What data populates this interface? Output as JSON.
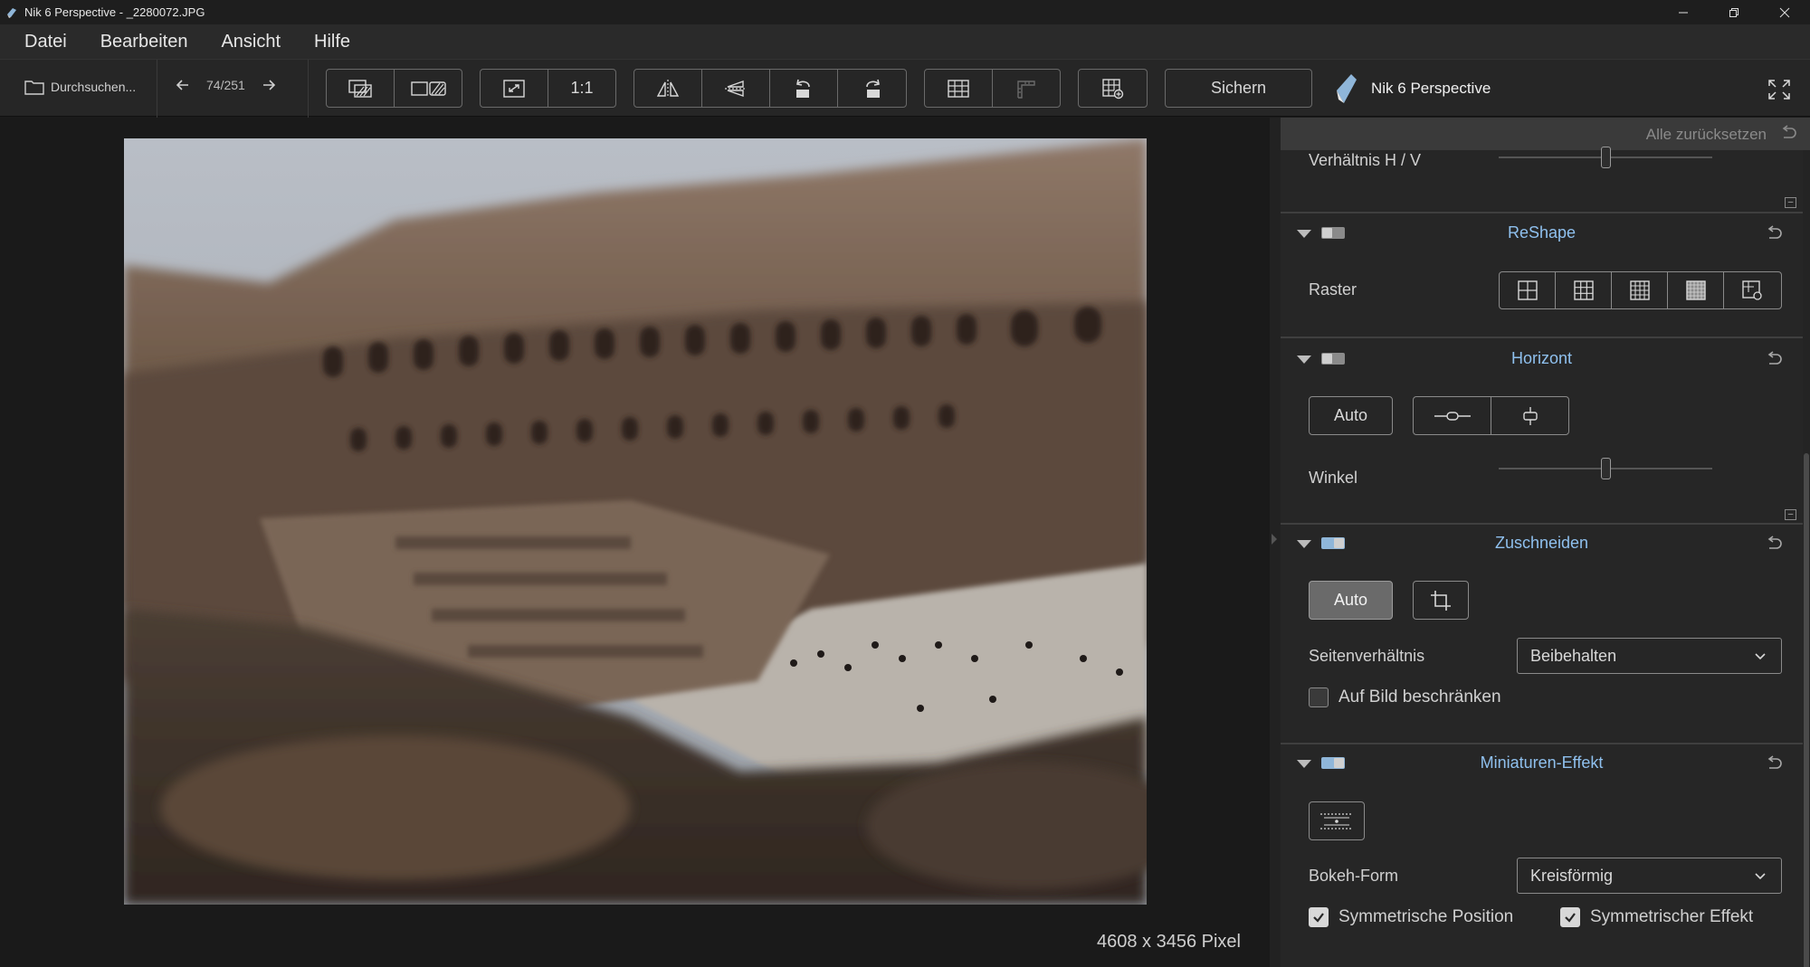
{
  "window": {
    "title": "Nik 6 Perspective - _2280072.JPG"
  },
  "menu": {
    "items": [
      "Datei",
      "Bearbeiten",
      "Ansicht",
      "Hilfe"
    ]
  },
  "toolbar": {
    "browse_label": "Durchsuchen...",
    "pager": "74/251",
    "zoom_1to1": "1:1",
    "save_label": "Sichern",
    "brand": "Nik 6 Perspective"
  },
  "canvas": {
    "image_size": "4608 x 3456 Pixel"
  },
  "panel": {
    "reset_all": "Alle zurücksetzen",
    "ratio_label": "Verhältnis H / V",
    "ratio_value": 0.5,
    "reshape": {
      "title": "ReShape",
      "grid_label": "Raster"
    },
    "horizont": {
      "title": "Horizont",
      "auto_label": "Auto",
      "angle_label": "Winkel",
      "angle_value": 0.5
    },
    "crop": {
      "title": "Zuschneiden",
      "auto_label": "Auto",
      "aspect_label": "Seitenverhältnis",
      "aspect_value": "Beibehalten",
      "constrain_label": "Auf Bild beschränken",
      "constrain_checked": false
    },
    "miniature": {
      "title": "Miniaturen-Effekt",
      "bokeh_label": "Bokeh-Form",
      "bokeh_value": "Kreisförmig",
      "sym_position_label": "Symmetrische Position",
      "sym_position_checked": true,
      "sym_effect_label": "Symmetrischer Effekt",
      "sym_effect_checked": true
    }
  },
  "colors": {
    "accent": "#8fc0ee",
    "background": "#1b1b1b",
    "panel": "#262626"
  }
}
